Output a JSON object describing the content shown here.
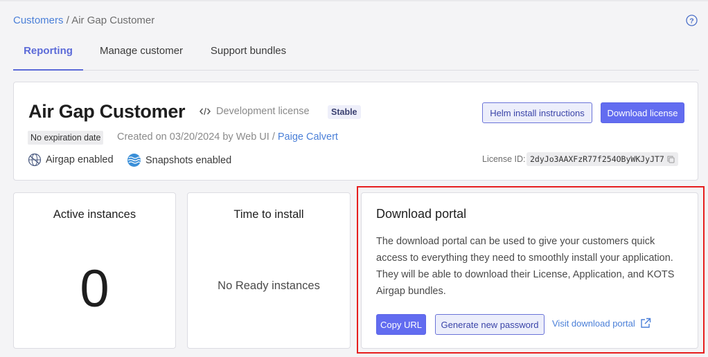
{
  "breadcrumb": {
    "parent": "Customers",
    "separator": "/",
    "current": "Air Gap Customer"
  },
  "tabs": [
    {
      "label": "Reporting",
      "active": true
    },
    {
      "label": "Manage customer",
      "active": false
    },
    {
      "label": "Support bundles",
      "active": false
    }
  ],
  "customer": {
    "name": "Air Gap Customer",
    "license_type": "Development license",
    "channel": "Stable",
    "expiration": "No expiration date",
    "created_text": "Created on 03/20/2024 by Web UI /",
    "created_by": "Paige Calvert",
    "features": [
      "Airgap enabled",
      "Snapshots enabled"
    ],
    "license_id_label": "License ID:",
    "license_id": "2dyJo3AAXFzR77f254OByWKJyJT7",
    "helm_button": "Helm install instructions",
    "download_button": "Download license"
  },
  "stats": {
    "active_title": "Active instances",
    "active_value": "0",
    "install_title": "Time to install",
    "install_value": "No Ready instances"
  },
  "download_portal": {
    "title": "Download portal",
    "description": "The download portal can be used to give your customers quick access to everything they need to smoothly install your application. They will be able to download their License, Application, and KOTS Airgap bundles.",
    "copy_button": "Copy URL",
    "generate_button": "Generate new password",
    "visit_link": "Visit download portal"
  },
  "colors": {
    "accent": "#626cf0",
    "link": "#4a7fd8",
    "highlight": "#e61e1e"
  }
}
